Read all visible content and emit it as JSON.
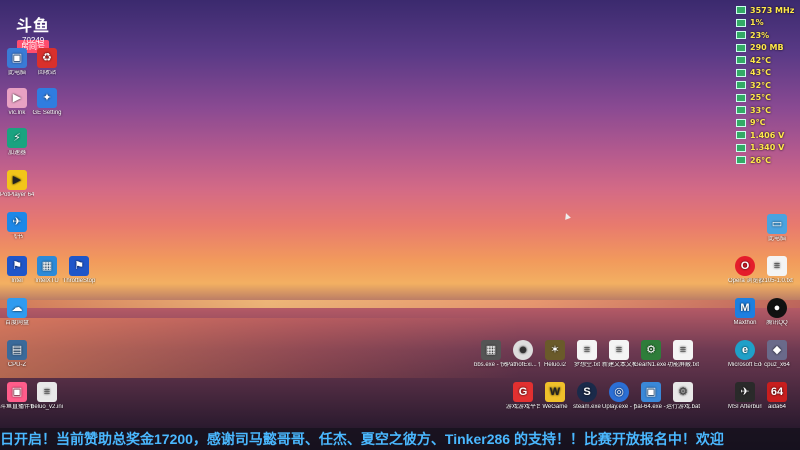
{
  "logo": {
    "mark": "斗鱼",
    "badge": "房间号",
    "room_number": "70249"
  },
  "monitor": {
    "rows": [
      "3573 MHz",
      "1%",
      "23%",
      "290 MB",
      "42°C",
      "43°C",
      "32°C",
      "25°C",
      "33°C",
      "9°C",
      "1.406 V",
      "1.340 V",
      "26°C"
    ]
  },
  "icons": {
    "left": [
      {
        "label": "此电脑",
        "name": "desktop-icon-pc"
      },
      {
        "label": "回收站",
        "name": "desktop-icon-recycle"
      },
      {
        "label": "vlc.lnk",
        "name": "desktop-icon-vlc"
      },
      {
        "label": "GE Setting",
        "name": "desktop-icon-ge-setting"
      },
      {
        "label": "加速器",
        "name": "desktop-icon-accelerator"
      },
      {
        "label": "PotPlayer 64 bit",
        "name": "desktop-icon-potplayer"
      },
      {
        "label": "飞书",
        "name": "desktop-icon-feishu"
      },
      {
        "label": "Intel",
        "name": "desktop-icon-intel-1"
      },
      {
        "label": "IntelXTU",
        "name": "desktop-icon-intel-2"
      },
      {
        "label": "ThrottleStop",
        "name": "desktop-icon-intel-3"
      },
      {
        "label": "百度网盘",
        "name": "desktop-icon-baidu"
      },
      {
        "label": "CPU-Z",
        "name": "desktop-icon-cpuz-left"
      },
      {
        "label": "斗鱼直播伴侣工具",
        "name": "desktop-icon-douyu-tool"
      },
      {
        "label": "heluo_v2.ini",
        "name": "desktop-icon-ini"
      }
    ],
    "right": [
      {
        "label": "此电脑",
        "name": "desktop-icon-computer-right"
      },
      {
        "label": "Opera 浏览器",
        "name": "desktop-icon-opera"
      },
      {
        "label": "2105-1.0.txt",
        "name": "desktop-icon-txt-right"
      },
      {
        "label": "Maxthon",
        "name": "desktop-icon-maxthon"
      },
      {
        "label": "腾讯QQ",
        "name": "desktop-icon-qq"
      },
      {
        "label": "Microsoft Edge",
        "name": "desktop-icon-edge"
      },
      {
        "label": "cpuz_x64",
        "name": "desktop-icon-cpuz"
      },
      {
        "label": "MSI Afterburner",
        "name": "desktop-icon-msi"
      },
      {
        "label": "aida64",
        "name": "desktop-icon-aida64"
      }
    ],
    "bottom_row1": [
      {
        "label": "bbs.exe - 快捷方式",
        "name": "desktop-icon-bbs"
      },
      {
        "label": "PathofExi... 快捷方式",
        "name": "desktop-icon-pathofexile"
      },
      {
        "label": "Heluo.i2",
        "name": "desktop-icon-heluo"
      },
      {
        "label": "梦想空.txt",
        "name": "desktop-icon-txt-1"
      },
      {
        "label": "新建文本文档.txt",
        "name": "desktop-icon-txt-2"
      },
      {
        "label": "GearN1.exe - 快捷方式",
        "name": "desktop-icon-gearn1"
      },
      {
        "label": "功能屏蔽.txt",
        "name": "desktop-icon-txt-3"
      }
    ],
    "bottom_row2": [
      {
        "label": "游戏游戏平台",
        "name": "desktop-icon-game-platform"
      },
      {
        "label": "WeGame",
        "name": "desktop-icon-wegame"
      },
      {
        "label": "steam.exe",
        "name": "desktop-icon-steam"
      },
      {
        "label": "Uplay.exe - 快捷方式",
        "name": "desktop-icon-uplay"
      },
      {
        "label": "pal-64.exe - 快捷方式",
        "name": "desktop-icon-pal64"
      },
      {
        "label": "运行游戏.bat - 快捷方式",
        "name": "desktop-icon-bat"
      }
    ]
  },
  "ticker": {
    "text": "日开启！当前赞助总奖金17200，感谢司马懿哥哥、任杰、夏空之彼方、Tinker286 的支持！！比赛开放报名中！欢迎"
  },
  "colors": {
    "ticker_text": "#4ab8ff",
    "monitor_text": "#ffe84a"
  }
}
